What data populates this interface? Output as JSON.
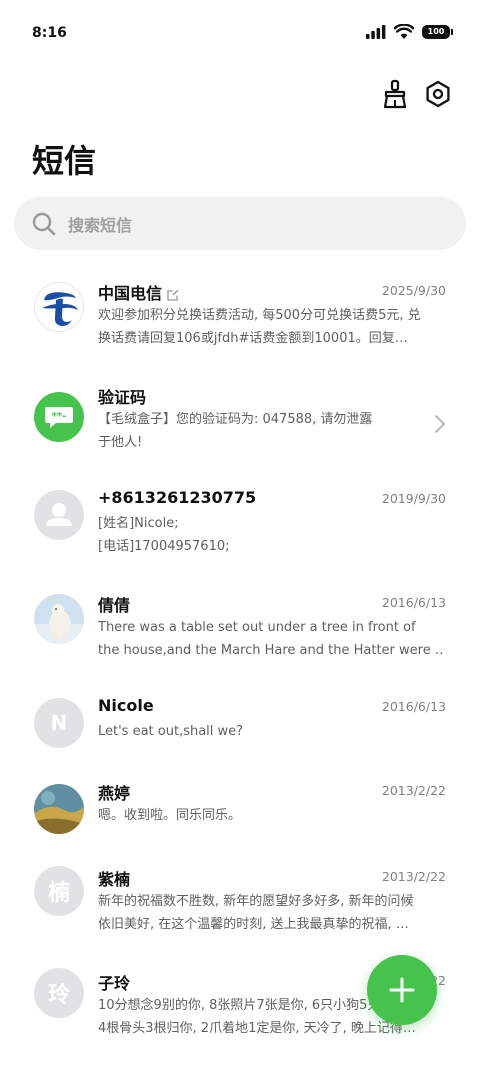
{
  "status_bar": {
    "time": "8:16",
    "battery": "100"
  },
  "header": {
    "title": "短信",
    "clean_icon": "broom-icon",
    "settings_icon": "hexagon-settings-icon"
  },
  "search": {
    "placeholder": "搜索短信"
  },
  "conversations": [
    {
      "name": "中国电信",
      "date": "2025/9/30",
      "preview_lines": [
        "欢迎参加积分兑换话费活动, 每500分可兑换话费5元, 兑",
        "换话费请回复106或jfdh#话费金额到10001。回复…"
      ]
    },
    {
      "name": "验证码",
      "date": "",
      "preview_lines": [
        "【毛绒盒子】您的验证码为: 047588, 请勿泄露",
        "于他人!"
      ]
    },
    {
      "name": "+8613261230775",
      "date": "2019/9/30",
      "preview_lines": [
        "[姓名]Nicole;",
        "[电话]17004957610;"
      ]
    },
    {
      "name": "倩倩",
      "date": "2016/6/13",
      "preview_lines": [
        "There was a table set out under a tree in front of",
        "the house,and the March Hare and the Hatter were …"
      ]
    },
    {
      "name": "Nicole",
      "date": "2016/6/13",
      "avatar_letter": "N",
      "preview_lines": [
        "Let's eat out,shall we?"
      ]
    },
    {
      "name": "燕婷",
      "date": "2013/2/22",
      "preview_lines": [
        "嗯。收到啦。同乐同乐。"
      ]
    },
    {
      "name": "紫楠",
      "date": "2013/2/22",
      "avatar_letter": "楠",
      "preview_lines": [
        "新年的祝福数不胜数, 新年的愿望好多好多, 新年的问候",
        "依旧美好, 在这个温馨的时刻, 送上我最真挚的祝福, …"
      ]
    },
    {
      "name": "子玲",
      "date": "2013/2/22",
      "avatar_letter": "玲",
      "preview_lines": [
        "10分想念9别的你, 8张照片7张是你, 6只小狗5只像你,",
        "4根骨头3根归你, 2爪着地1定是你, 天冷了, 晚上记得…"
      ]
    }
  ],
  "colors": {
    "accent_green": "#45c34c",
    "telecom_blue": "#1b4fa3",
    "avatar_gray": "#e2e2e4"
  },
  "fab": {
    "icon": "plus-icon"
  }
}
